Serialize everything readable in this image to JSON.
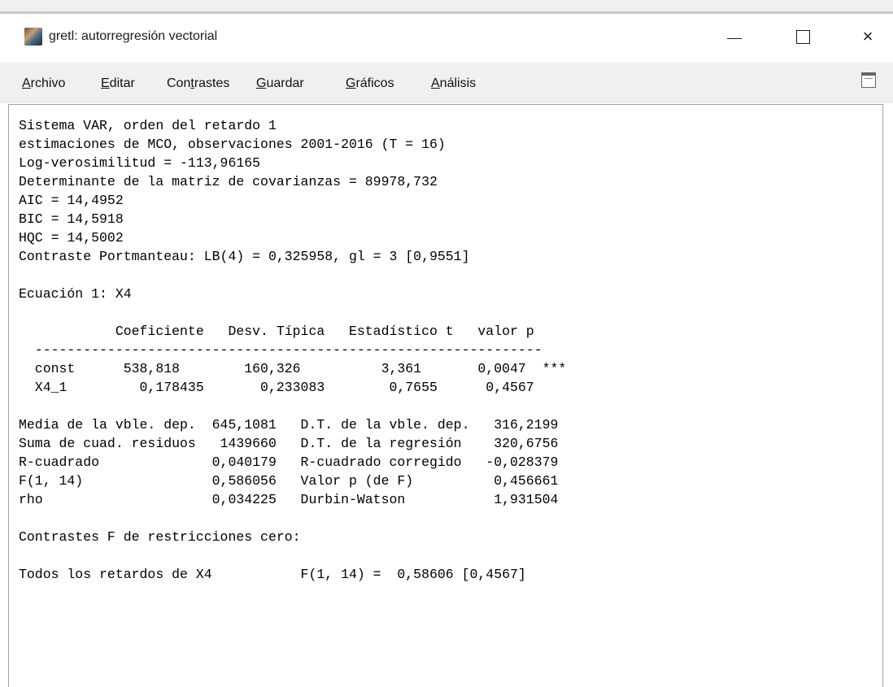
{
  "window": {
    "title": "gretl: autorregresión vectorial",
    "minimize_label": "",
    "maximize_label": "",
    "close_label": "×"
  },
  "menubar": {
    "items": [
      {
        "pre": "",
        "u": "A",
        "post": "rchivo"
      },
      {
        "pre": "",
        "u": "E",
        "post": "ditar"
      },
      {
        "pre": "Con",
        "u": "t",
        "post": "rastes"
      },
      {
        "pre": "",
        "u": "G",
        "post": "uardar"
      },
      {
        "pre": "",
        "u": "G",
        "post": "ráficos"
      },
      {
        "pre": "",
        "u": "A",
        "post": "nálisis"
      }
    ]
  },
  "output": {
    "lines": [
      "Sistema VAR, orden del retardo 1",
      "estimaciones de MCO, observaciones 2001-2016 (T = 16)",
      "Log-verosimilitud = -113,96165",
      "Determinante de la matriz de covarianzas = 89978,732",
      "AIC = 14,4952",
      "BIC = 14,5918",
      "HQC = 14,5002",
      "Contraste Portmanteau: LB(4) = 0,325958, gl = 3 [0,9551]",
      "",
      "Ecuación 1: X4",
      "",
      "            Coeficiente   Desv. Típica   Estadístico t   valor p",
      "  ---------------------------------------------------------------",
      "  const      538,818        160,326          3,361       0,0047  ***",
      "  X4_1         0,178435       0,233083        0,7655      0,4567",
      "",
      "Media de la vble. dep.  645,1081   D.T. de la vble. dep.   316,2199",
      "Suma de cuad. residuos   1439660   D.T. de la regresión    320,6756",
      "R-cuadrado              0,040179   R-cuadrado corregido   -0,028379",
      "F(1, 14)                0,586056   Valor p (de F)          0,456661",
      "rho                     0,034225   Durbin-Watson           1,931504",
      "",
      "Contrastes F de restricciones cero:",
      "",
      "Todos los retardos de X4           F(1, 14) =  0,58606 [0,4567]"
    ]
  }
}
